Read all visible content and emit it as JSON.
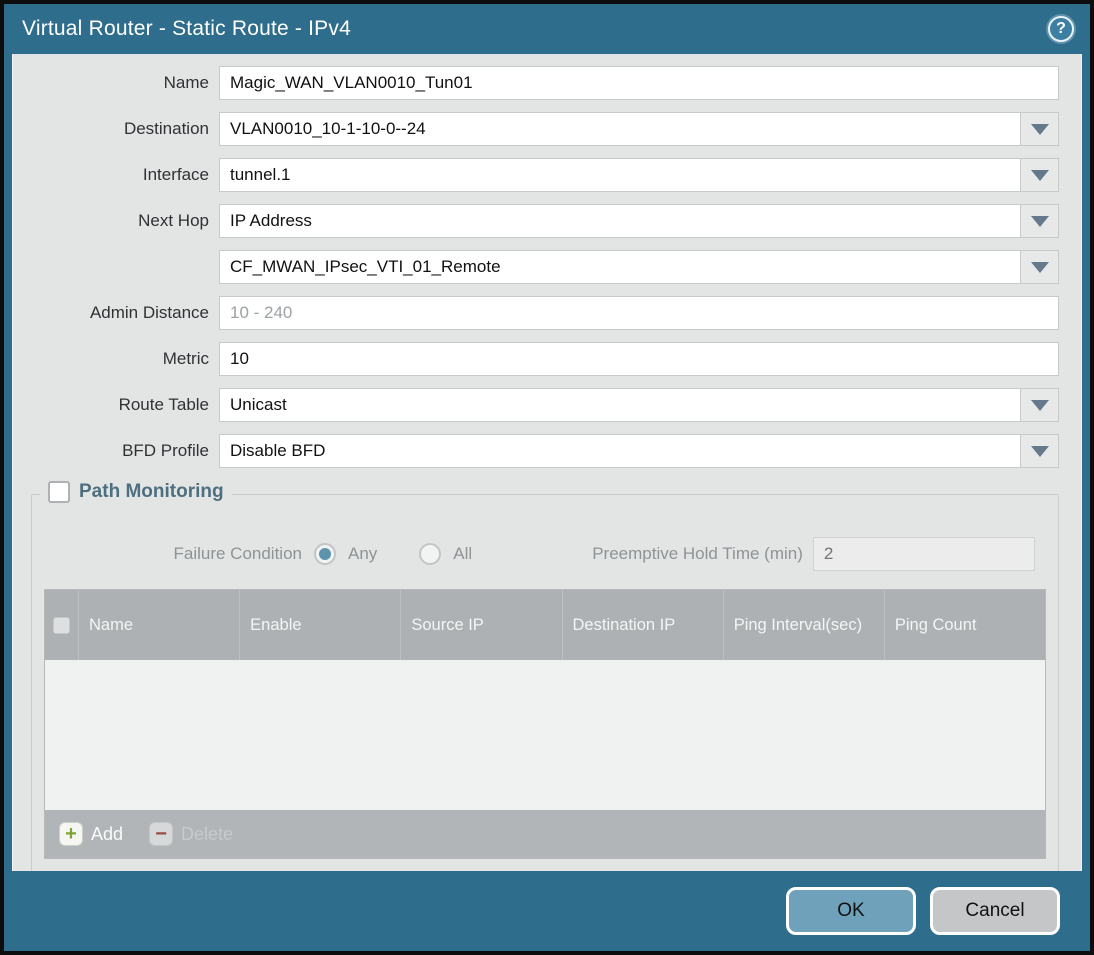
{
  "dialog": {
    "title": "Virtual Router - Static Route - IPv4",
    "help_glyph": "?"
  },
  "form": {
    "name": {
      "label": "Name",
      "value": "Magic_WAN_VLAN0010_Tun01"
    },
    "destination": {
      "label": "Destination",
      "value": "VLAN0010_10-1-10-0--24"
    },
    "interface": {
      "label": "Interface",
      "value": "tunnel.1"
    },
    "next_hop": {
      "label": "Next Hop",
      "value": "IP Address"
    },
    "next_hop_value": {
      "value": "CF_MWAN_IPsec_VTI_01_Remote"
    },
    "admin_distance": {
      "label": "Admin Distance",
      "placeholder": "10 - 240"
    },
    "metric": {
      "label": "Metric",
      "value": "10"
    },
    "route_table": {
      "label": "Route Table",
      "value": "Unicast"
    },
    "bfd_profile": {
      "label": "BFD Profile",
      "value": "Disable BFD"
    }
  },
  "path_monitoring": {
    "title": "Path Monitoring",
    "checkbox_checked": false,
    "failure_condition_label": "Failure Condition",
    "radio_any_label": "Any",
    "radio_all_label": "All",
    "radio_selected": "Any",
    "preemptive_hold_label": "Preemptive Hold Time (min)",
    "preemptive_hold_value": "2",
    "table": {
      "columns": [
        "Name",
        "Enable",
        "Source IP",
        "Destination IP",
        "Ping Interval(sec)",
        "Ping Count"
      ],
      "rows": []
    },
    "add_label": "Add",
    "delete_label": "Delete",
    "add_icon_glyph": "+",
    "delete_icon_glyph": "−"
  },
  "footer": {
    "ok_label": "OK",
    "cancel_label": "Cancel"
  },
  "colors": {
    "titlebar_teal": "#2e6d8c",
    "content_bg": "#e3e5e5",
    "table_header_bg": "#adb1b3",
    "radio_selected_fill": "#5e93ad",
    "ok_button_bg": "#6fa2ba",
    "cancel_button_bg": "#c4c6c8",
    "add_icon_green": "#7fa234",
    "delete_icon_red": "#95483f"
  }
}
